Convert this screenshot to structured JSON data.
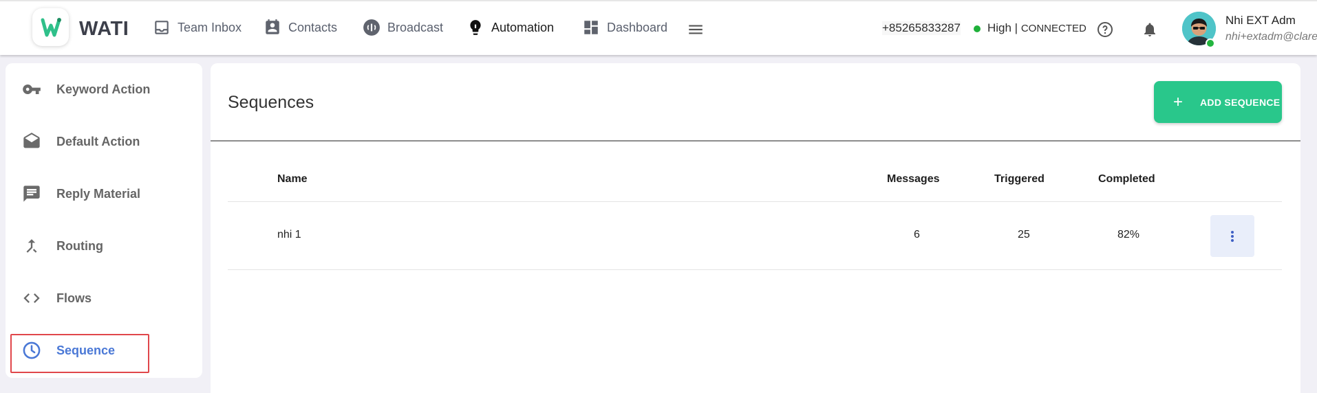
{
  "brand": {
    "name": "WATI"
  },
  "nav": {
    "team_inbox": "Team Inbox",
    "contacts": "Contacts",
    "broadcast": "Broadcast",
    "automation": "Automation",
    "dashboard": "Dashboard"
  },
  "status": {
    "phone": "+85265833287",
    "quality": "High |",
    "connection": "CONNECTED"
  },
  "user": {
    "name": "Nhi EXT Adm",
    "email": "nhi+extadm@clare."
  },
  "sidebar": {
    "items": [
      {
        "label": "Keyword Action",
        "icon": "key-icon"
      },
      {
        "label": "Default Action",
        "icon": "envelope-open-icon"
      },
      {
        "label": "Reply Material",
        "icon": "chat-icon"
      },
      {
        "label": "Routing",
        "icon": "merge-icon"
      },
      {
        "label": "Flows",
        "icon": "code-icon"
      },
      {
        "label": "Sequence",
        "icon": "clock-icon"
      }
    ]
  },
  "main": {
    "title": "Sequences",
    "add_button": "ADD SEQUENCE",
    "table": {
      "headers": {
        "name": "Name",
        "messages": "Messages",
        "triggered": "Triggered",
        "completed": "Completed"
      },
      "rows": [
        {
          "name": "nhi 1",
          "messages": "6",
          "triggered": "25",
          "completed": "82%"
        }
      ]
    }
  },
  "colors": {
    "accent_green": "#29c78b",
    "active_blue": "#4a78d6",
    "highlight_red": "#e0464a",
    "connected_green": "#1fb03a"
  }
}
